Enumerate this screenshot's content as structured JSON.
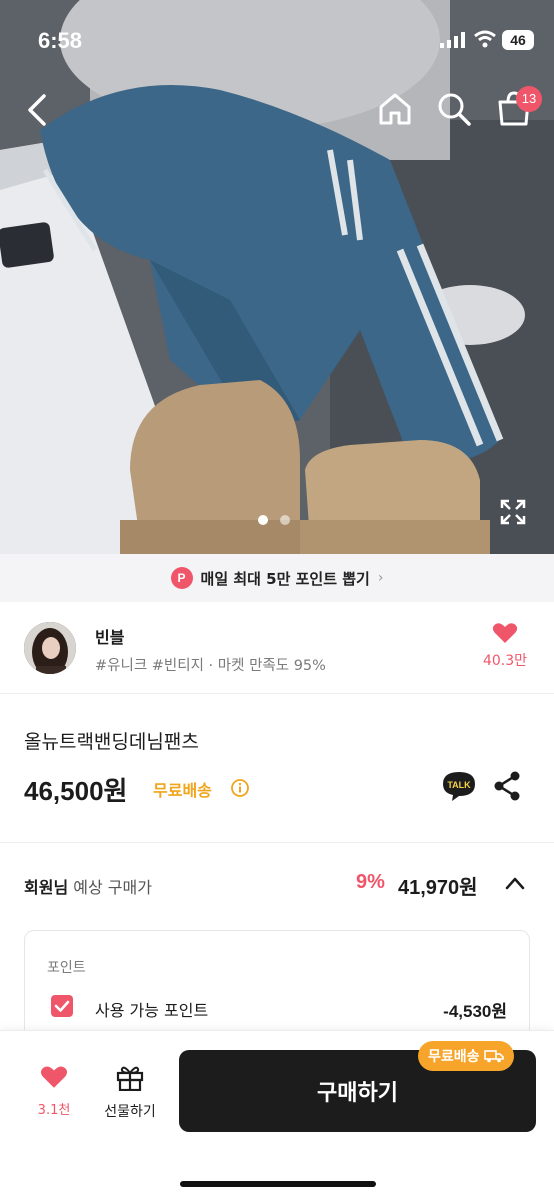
{
  "status_bar": {
    "time": "6:58",
    "battery": "46"
  },
  "header": {
    "back_icon": "chevron-left-icon",
    "home_icon": "home-icon",
    "search_icon": "search-icon",
    "cart_icon": "shopping-bag-icon",
    "cart_badge": "13"
  },
  "gallery": {
    "image_count": 2,
    "active_index": 0,
    "expand_icon": "expand-icon"
  },
  "promo": {
    "badge": "P",
    "text": "매일 최대 5만 포인트 뽑기",
    "chevron": "›"
  },
  "seller": {
    "name": "빈블",
    "tags": "#유니크 #빈티지 · 마켓 만족도 95%",
    "like_count": "40.3만"
  },
  "product": {
    "title": "올뉴트랙밴딩데님팬츠",
    "price": "46,500원",
    "free_shipping": "무료배송",
    "talk_label": "TALK"
  },
  "member_price": {
    "label_bold": "회원님",
    "label_rest": " 예상 구매가",
    "discount": "9%",
    "price": "41,970원"
  },
  "points": {
    "title": "포인트",
    "label": "사용 가능 포인트",
    "value": "-4,530원",
    "checked": true
  },
  "bottom_bar": {
    "like_count": "3.1천",
    "gift_label": "선물하기",
    "buy_label": "구매하기",
    "buy_badge": "무료배송"
  },
  "colors": {
    "accent": "#f0566a",
    "shipping": "#f0a51c",
    "buy_button": "#1c1c1c"
  }
}
